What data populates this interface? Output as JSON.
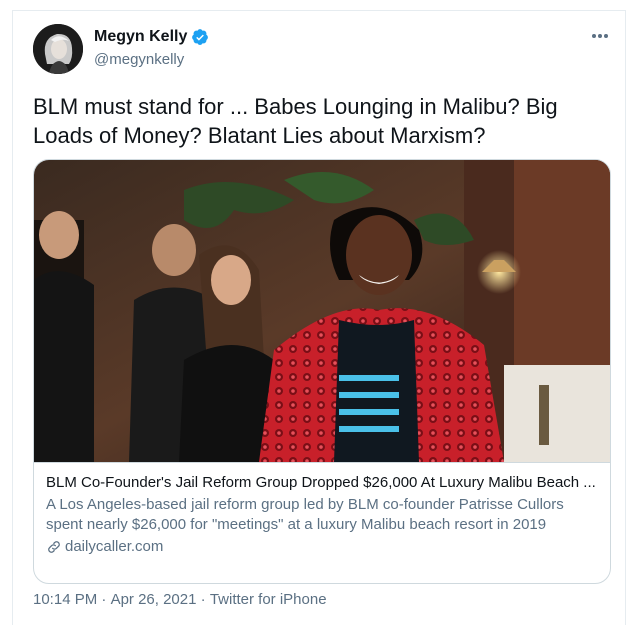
{
  "author": {
    "name": "Megyn Kelly",
    "handle": "@megynkelly",
    "verified": true,
    "avatar_icon": "profile-photo"
  },
  "tweet": {
    "text": "BLM must stand for ... Babes Lounging in Malibu? Big Loads of Money? Blatant Lies about Marxism?"
  },
  "card": {
    "image_description_icon": "photo",
    "title": "BLM Co-Founder's Jail Reform Group Dropped $26,000 At Luxury Malibu Beach ...",
    "description": "A Los Angeles-based jail reform group led by BLM co-founder Patrisse Cullors spent nearly $26,000 for \"meetings\" at a luxury Malibu beach resort in 2019",
    "domain": "dailycaller.com"
  },
  "meta": {
    "time": "10:14 PM",
    "separator": " · ",
    "date": "Apr 26, 2021",
    "source": "Twitter for iPhone"
  },
  "colors": {
    "verified_blue": "#1da1f2",
    "secondary_text": "#5b7083",
    "border": "#cfd9de"
  }
}
